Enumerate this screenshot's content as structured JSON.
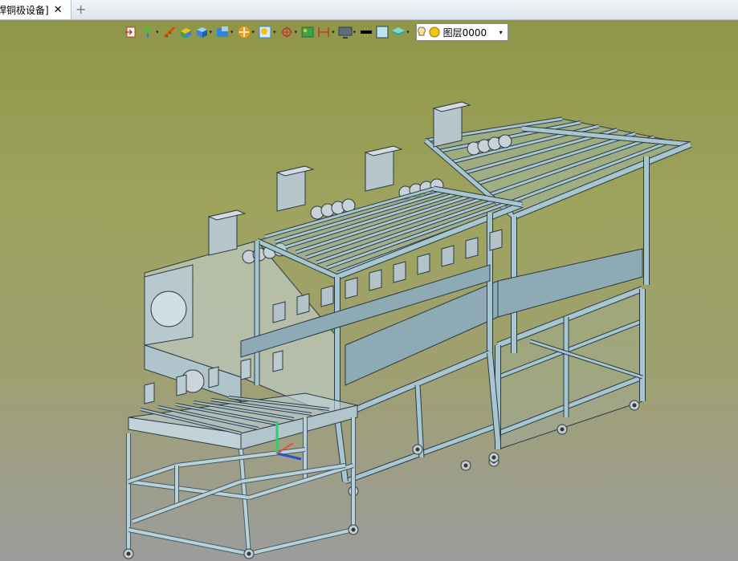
{
  "tabs": {
    "active_title": "焊铜极设备]",
    "close_glyph": "✕",
    "add_glyph": "+"
  },
  "toolbar": {
    "buttons": [
      {
        "name": "exit-sketch-icon",
        "dropdown": false
      },
      {
        "name": "snap-icon",
        "dropdown": true
      },
      {
        "name": "ruler-icon",
        "dropdown": false
      },
      {
        "name": "box-select-icon",
        "dropdown": false
      },
      {
        "name": "cube-shaded-icon",
        "dropdown": true
      },
      {
        "name": "view-orient-icon",
        "dropdown": true
      },
      {
        "name": "section-icon",
        "dropdown": true
      },
      {
        "name": "zoom-fit-icon",
        "dropdown": true
      },
      {
        "name": "pivot-icon",
        "dropdown": true
      },
      {
        "name": "image-icon",
        "dropdown": false
      },
      {
        "name": "dimension-icon",
        "dropdown": true
      },
      {
        "name": "display-icon",
        "dropdown": true
      },
      {
        "name": "line-weight-icon",
        "dropdown": false
      },
      {
        "name": "color-swatch-icon",
        "dropdown": false
      },
      {
        "name": "layers-icon",
        "dropdown": true
      }
    ],
    "dropdown_glyph": "▾",
    "layer": {
      "name": "图层0000",
      "arrow": "▾"
    }
  },
  "colors": {
    "frame": "#a8c6d2",
    "frame_dark": "#2d3a40",
    "panel": "#8eaab5",
    "wheel": "#c8cccf"
  }
}
